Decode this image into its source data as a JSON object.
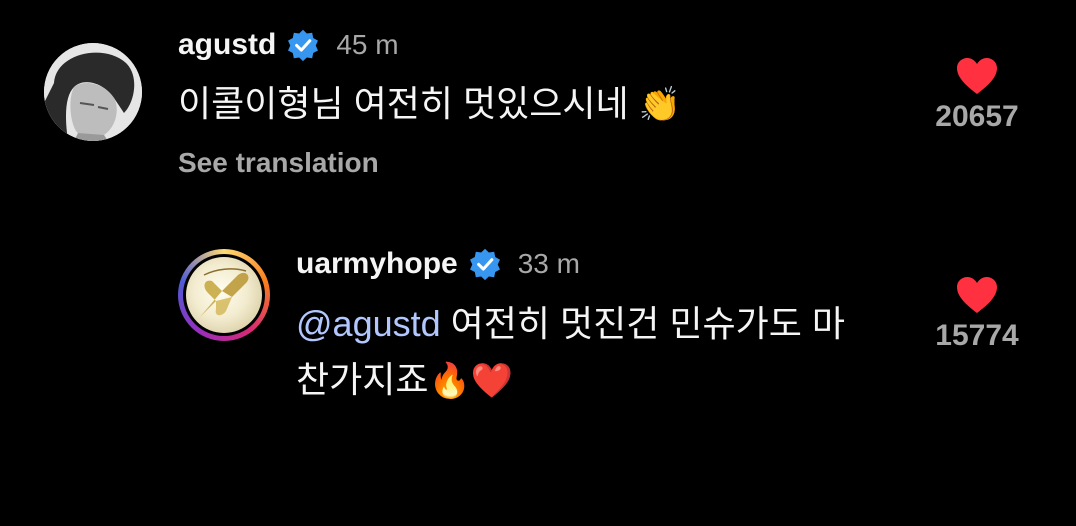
{
  "comments": [
    {
      "username": "agustd",
      "time": "45 m",
      "text": "이콜이형님 여전히 멋있으시네",
      "emoji": "👏",
      "see_translation": "See translation",
      "likes": "20657"
    },
    {
      "username": "uarmyhope",
      "time": "33 m",
      "mention": "@agustd",
      "text_line1": " 여전히 멋진건 민슈가도 마",
      "text_line2": "찬가지죠",
      "emoji": "🔥❤️",
      "likes": "15774"
    }
  ],
  "colors": {
    "background": "#000000",
    "text": "#f5f5f5",
    "secondary": "#a8a8a8",
    "mention": "#b3c7ff",
    "verified": "#3797f0",
    "heart": "#ff3040"
  },
  "icons": [
    "verified-badge-icon",
    "heart-icon"
  ]
}
